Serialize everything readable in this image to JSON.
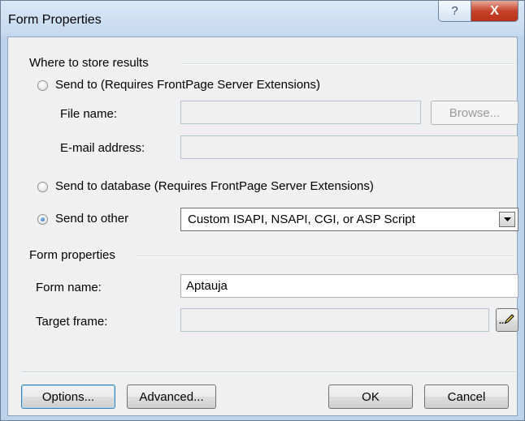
{
  "window": {
    "title": "Form Properties",
    "help_glyph": "?",
    "close_glyph": "X"
  },
  "store_results": {
    "group_label": "Where to store results",
    "send_to": {
      "label": "Send to (Requires FrontPage Server Extensions)",
      "selected": false,
      "file_name_label": "File name:",
      "file_name_value": "",
      "browse_label": "Browse...",
      "email_label": "E-mail address:",
      "email_value": ""
    },
    "send_to_database": {
      "label": "Send to database (Requires FrontPage Server Extensions)",
      "selected": false
    },
    "send_to_other": {
      "label": "Send to other",
      "selected": true,
      "dropdown_value": "Custom ISAPI, NSAPI, CGI, or ASP Script"
    }
  },
  "form_properties": {
    "group_label": "Form properties",
    "form_name_label": "Form name:",
    "form_name_value": "Aptauja",
    "target_frame_label": "Target frame:",
    "target_frame_value": "",
    "target_frame_button": "..."
  },
  "buttons": {
    "options": "Options...",
    "advanced": "Advanced...",
    "ok": "OK",
    "cancel": "Cancel"
  },
  "icons": {
    "dropdown_arrow": "chevron-down-icon",
    "target_frame": "pencil-icon"
  }
}
